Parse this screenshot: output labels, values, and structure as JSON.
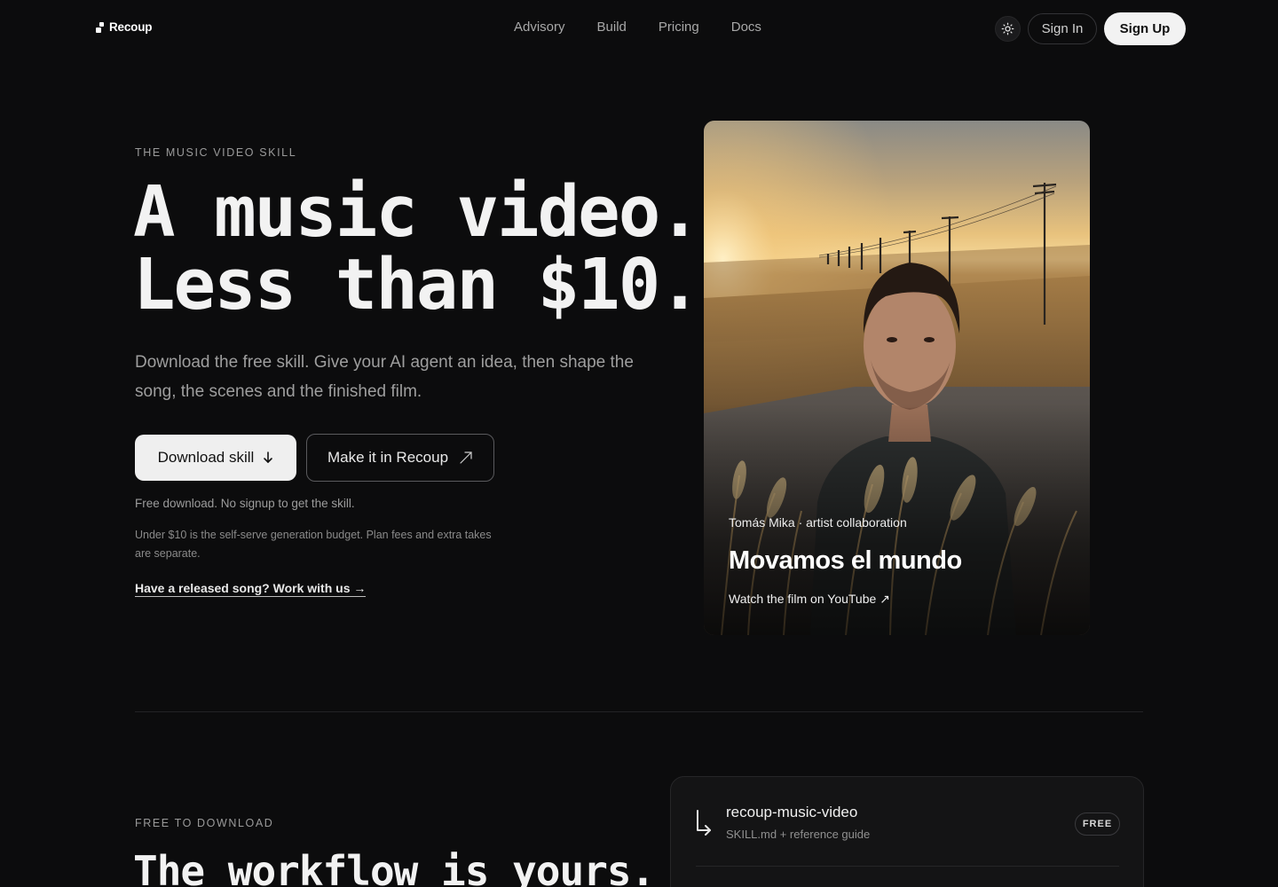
{
  "nav": {
    "brand": "Recoup",
    "links": [
      "Advisory",
      "Build",
      "Pricing",
      "Docs"
    ],
    "theme_icon": "sun-icon",
    "sign_in": "Sign In",
    "sign_up": "Sign Up"
  },
  "hero": {
    "eyebrow": "THE MUSIC VIDEO SKILL",
    "headline_line1": "A music video.",
    "headline_line2": "Less than $10.",
    "subtitle": "Download the free skill. Give your AI agent an idea, then shape the song, the scenes and the finished film.",
    "download_label": "Download skill",
    "download_icon": "arrow-down-icon",
    "make_label": "Make it in Recoup",
    "make_icon": "arrow-up-right-icon",
    "note_free": "Free download. No signup to get the skill.",
    "note_budget": "Under $10 is the self-serve generation budget. Plan fees and extra takes are separate.",
    "work_link": "Have a released song? Work with us →"
  },
  "video_card": {
    "meta": "Tomás Mika · artist collaboration",
    "title": "Movamos el mundo",
    "link": "Watch the film on YouTube ↗"
  },
  "section2": {
    "eyebrow": "FREE TO DOWNLOAD",
    "headline": "The workflow is yours.",
    "skill": {
      "name": "recoup-music-video",
      "sub": "SKILL.md + reference guide",
      "badge": "FREE",
      "icon": "arrow-return-icon"
    }
  },
  "colors": {
    "background": "#0c0c0d",
    "primary_button": "#efefef",
    "text": "#ececec",
    "muted": "#9e9e9e"
  }
}
